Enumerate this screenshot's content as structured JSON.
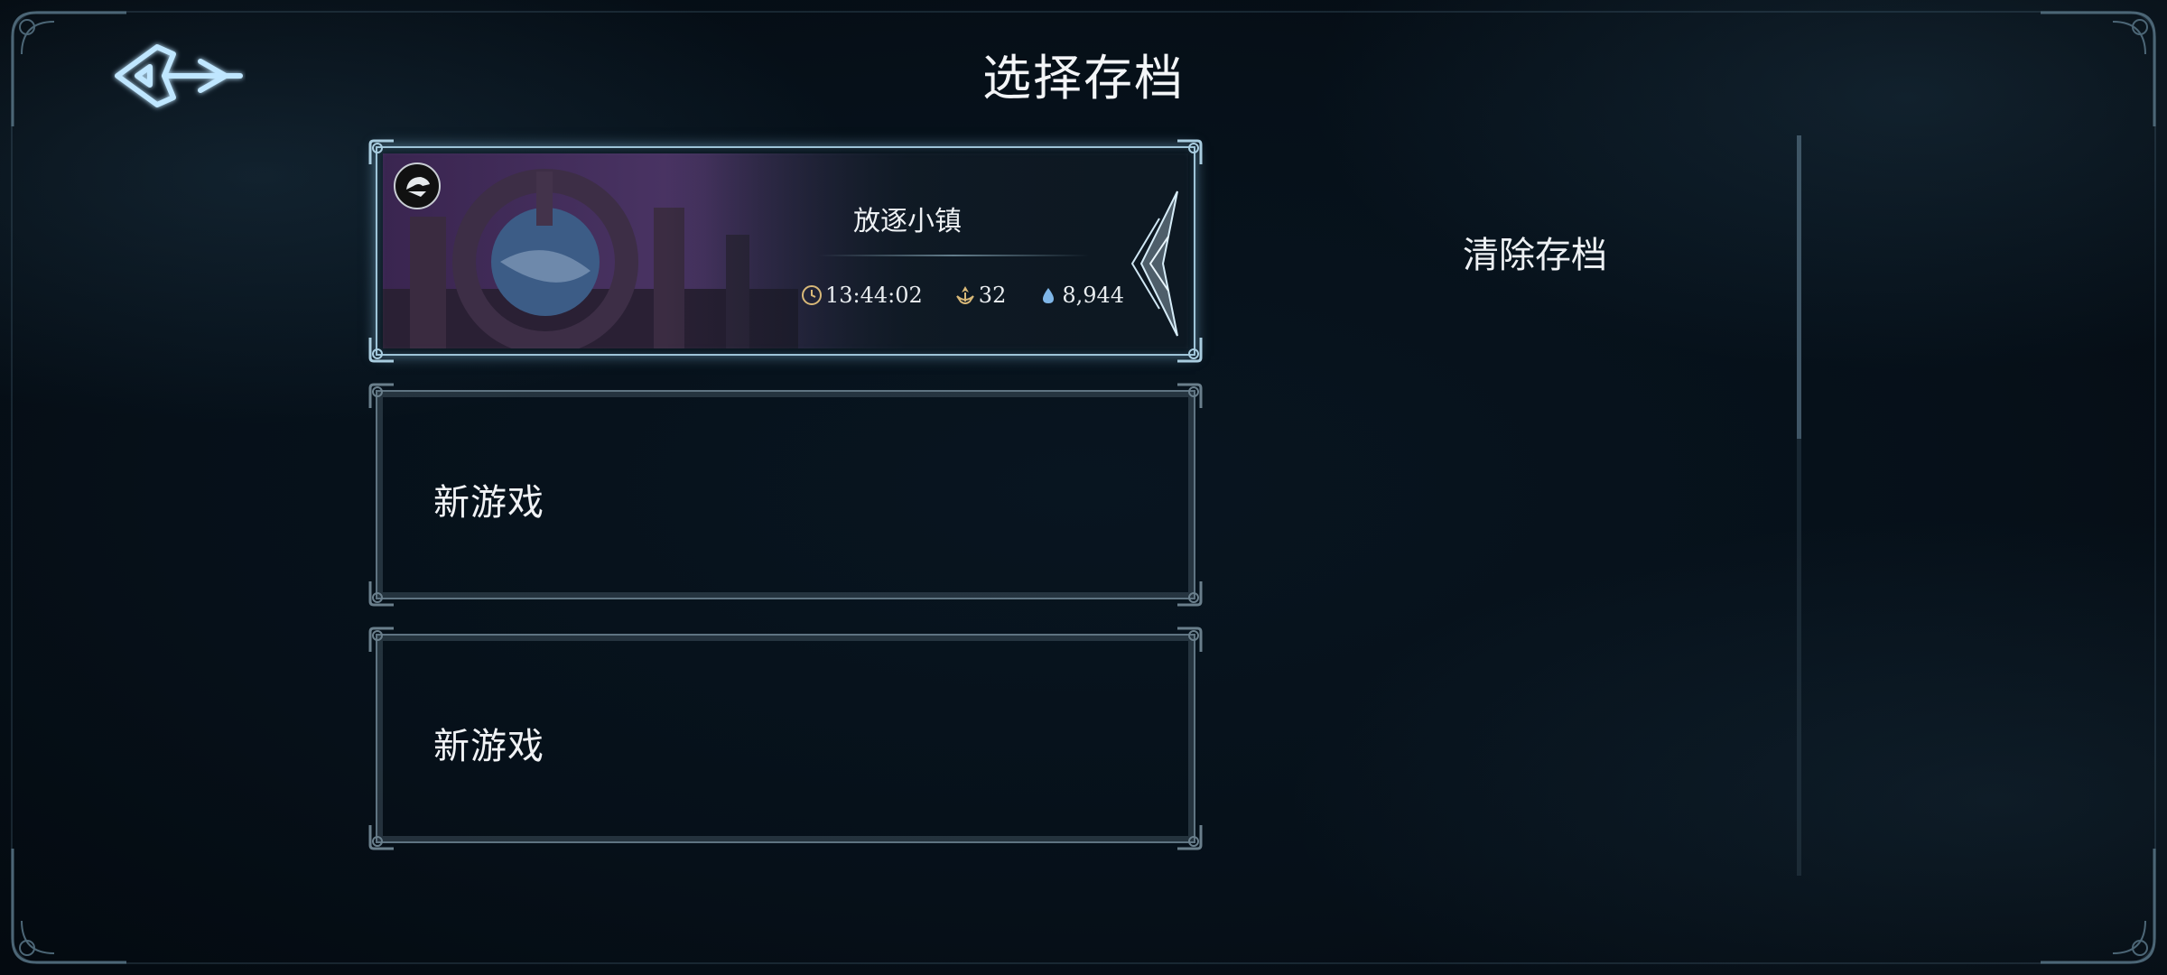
{
  "title": "选择存档",
  "back_button": {
    "icon": "back-arrow-icon"
  },
  "save_slots": [
    {
      "type": "save",
      "location": "放逐小镇",
      "stats": {
        "playtime": "13:44:02",
        "level": "32",
        "currency": "8,944"
      },
      "selected": true
    },
    {
      "type": "new",
      "label": "新游戏"
    },
    {
      "type": "new",
      "label": "新游戏"
    }
  ],
  "actions": {
    "clear_save": "清除存档"
  },
  "scroll": {
    "visible_fraction": 0.41,
    "position": 0
  },
  "colors": {
    "background": "#071018",
    "slot_border": "#5f7482",
    "selected_glow": "#9ec4d8",
    "text": "#eef1f4",
    "gold": "#d8b878",
    "blue_drop": "#7fb6e8"
  }
}
